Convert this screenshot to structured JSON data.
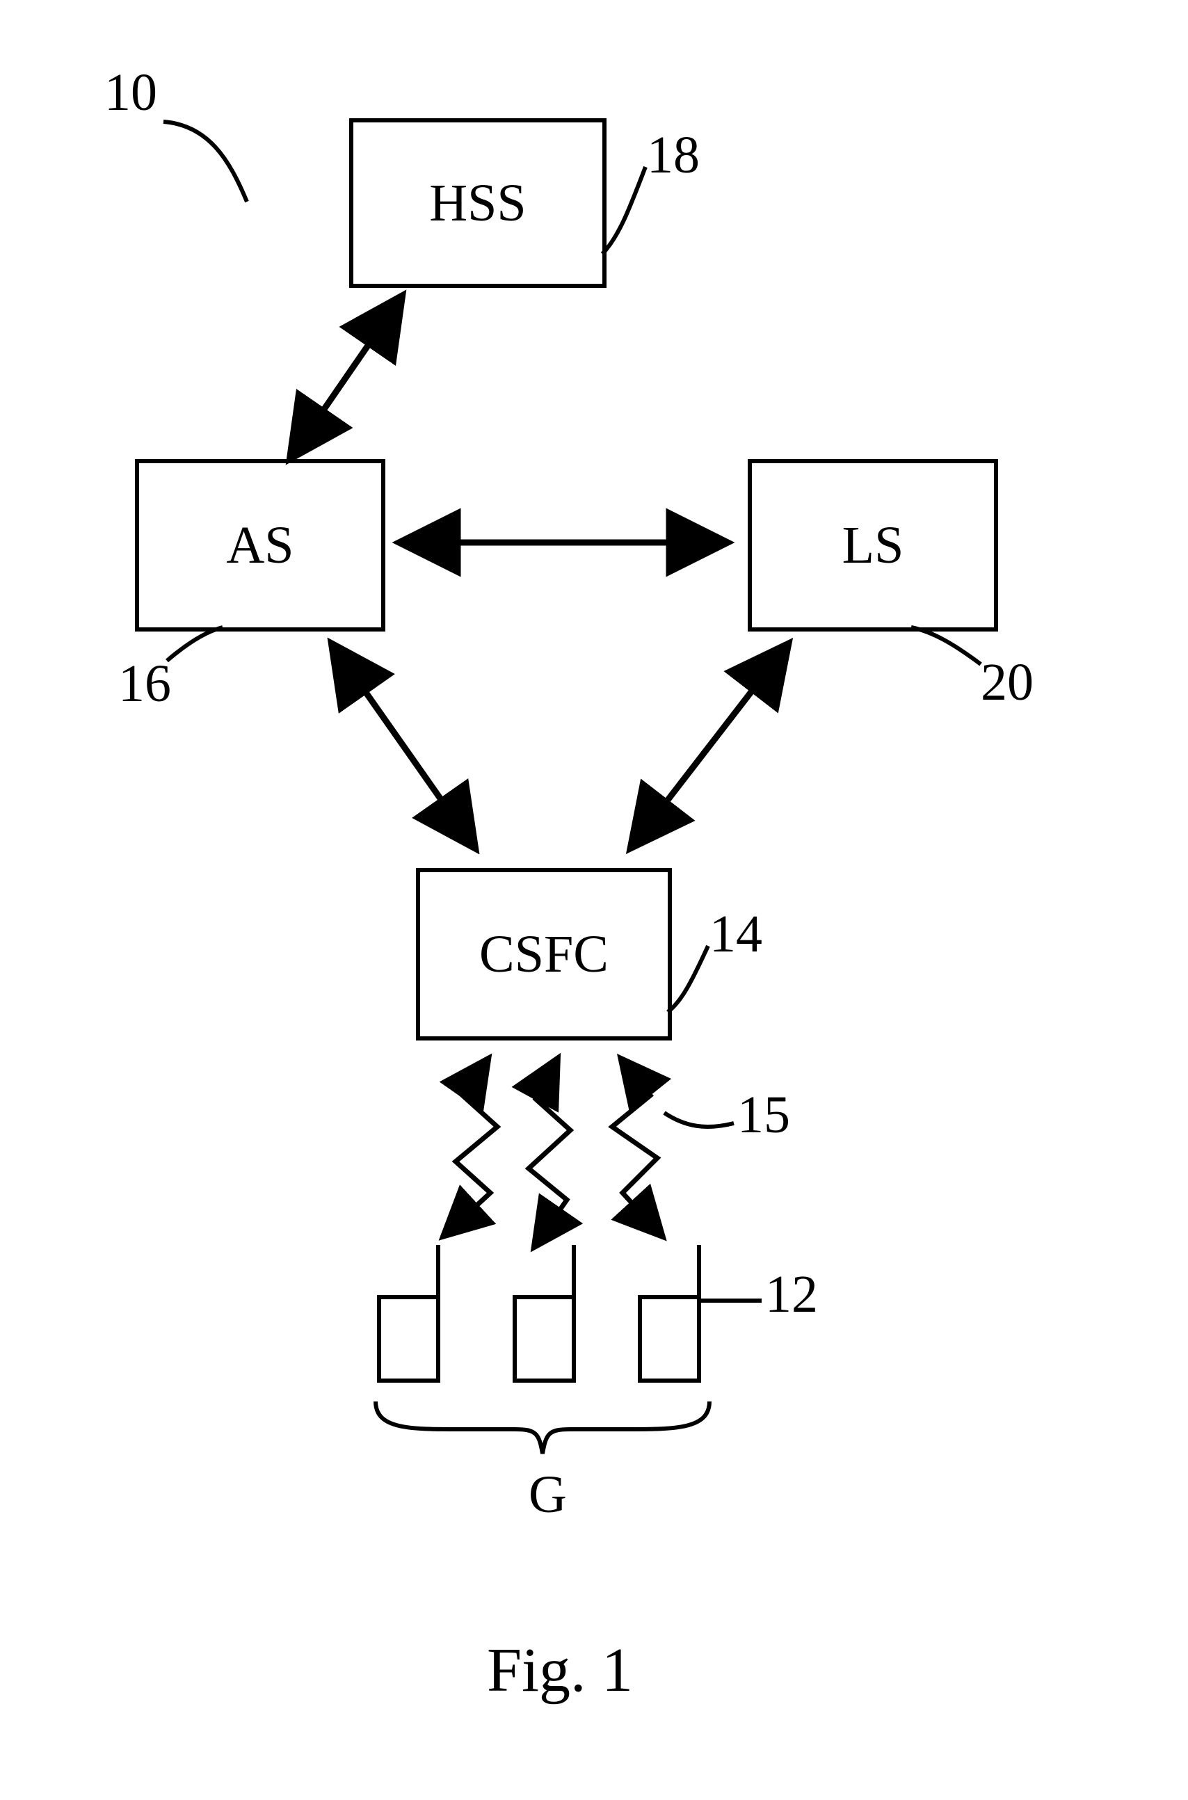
{
  "diagram": {
    "ref": "10",
    "figure_caption": "Fig. 1",
    "group_label": "G",
    "nodes": {
      "hss": {
        "text": "HSS",
        "ref": "18"
      },
      "as": {
        "text": "AS",
        "ref": "16"
      },
      "ls": {
        "text": "LS",
        "ref": "20"
      },
      "csfc": {
        "text": "CSFC",
        "ref": "14"
      }
    },
    "wireless": {
      "ref": "15"
    },
    "device": {
      "ref": "12"
    },
    "edges": [
      {
        "from": "hss",
        "to": "as",
        "bidirectional": true,
        "type": "solid"
      },
      {
        "from": "as",
        "to": "ls",
        "bidirectional": true,
        "type": "solid"
      },
      {
        "from": "as",
        "to": "csfc",
        "bidirectional": true,
        "type": "solid"
      },
      {
        "from": "ls",
        "to": "csfc",
        "bidirectional": true,
        "type": "solid"
      },
      {
        "from": "csfc",
        "to": "device_group",
        "bidirectional": true,
        "type": "wireless",
        "count": 3
      }
    ]
  }
}
